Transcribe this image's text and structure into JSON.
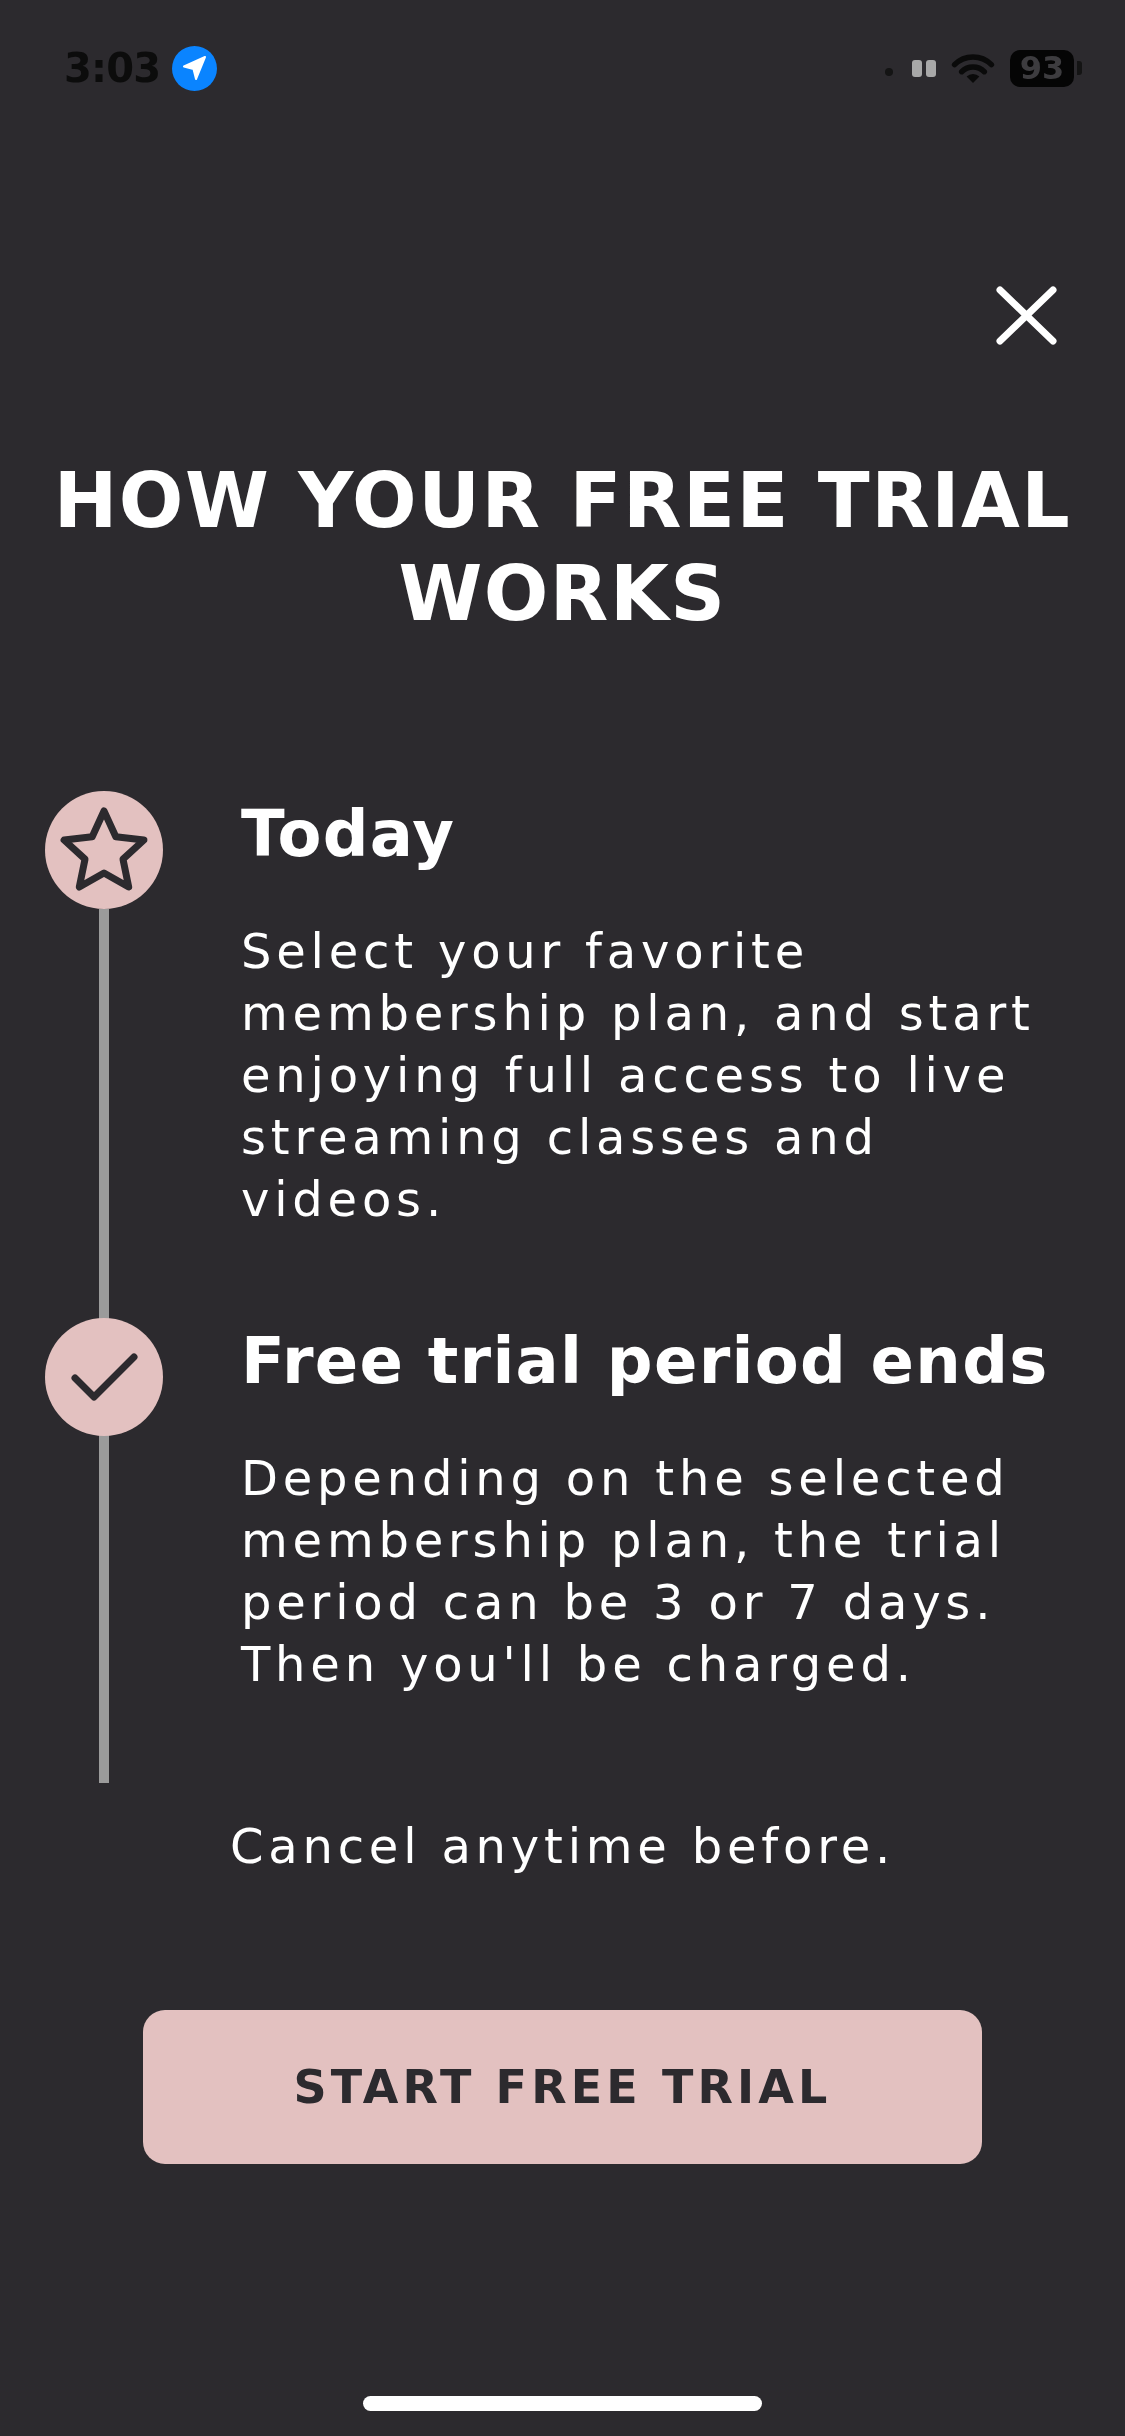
{
  "status_bar": {
    "time": "3:03",
    "battery": "93"
  },
  "title": "HOW YOUR FREE TRIAL WORKS",
  "steps": [
    {
      "title": "Today",
      "description": "Select your favorite membership plan, and start enjoying full access to live streaming classes and videos."
    },
    {
      "title": "Free trial period ends",
      "description": "Depending on the selected membership plan, the trial period can be 3 or 7 days. Then you'll be charged."
    }
  ],
  "note": "Cancel anytime before.",
  "start_button": {
    "label": "START FREE TRIAL"
  }
}
